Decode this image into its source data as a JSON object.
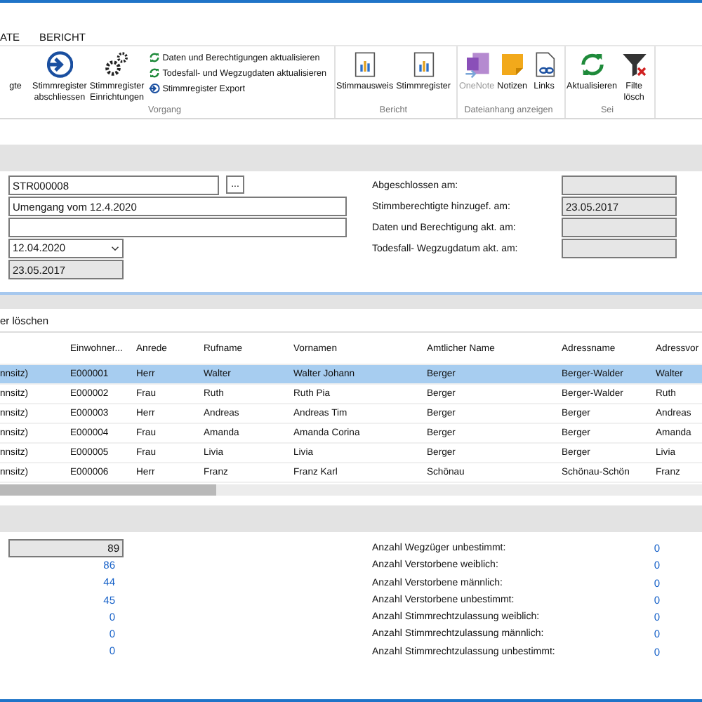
{
  "ribbon_tabs": [
    "ATE",
    "BERICHT"
  ],
  "ribbon_groups": [
    {
      "label": "Vorgang",
      "buttons": [
        {
          "kind": "none",
          "lines": [
            "gte"
          ],
          "disabled": false
        },
        {
          "kind": "arrow",
          "lines": [
            "Stimmregister",
            "abschliessen"
          ],
          "disabled": false
        },
        {
          "kind": "gears",
          "lines": [
            "Stimmregister",
            "Einrichtungen"
          ],
          "disabled": false
        }
      ],
      "small_buttons": [
        {
          "kind": "refresh",
          "label": "Daten und Berechtigungen aktualisieren"
        },
        {
          "kind": "refresh",
          "label": "Todesfall- und Wegzugdaten aktualisieren"
        },
        {
          "kind": "arrow",
          "label": "Stimmregister Export"
        }
      ]
    },
    {
      "label": "Bericht",
      "buttons": [
        {
          "kind": "report",
          "lines": [
            "Stimmausweis"
          ],
          "disabled": false
        },
        {
          "kind": "report",
          "lines": [
            "Stimmregister"
          ],
          "disabled": false
        }
      ]
    },
    {
      "label": "Dateianhang anzeigen",
      "buttons": [
        {
          "kind": "onenote",
          "lines": [
            "OneNote"
          ],
          "disabled": true
        },
        {
          "kind": "note",
          "lines": [
            "Notizen"
          ],
          "disabled": false
        },
        {
          "kind": "link",
          "lines": [
            "Links"
          ],
          "disabled": false
        }
      ]
    },
    {
      "label": "Sei",
      "buttons": [
        {
          "kind": "refresh",
          "lines": [
            "Aktualisieren"
          ],
          "disabled": false
        },
        {
          "kind": "filter",
          "lines": [
            "Filte",
            "lösch"
          ],
          "disabled": false
        }
      ]
    }
  ],
  "form": {
    "number": "STR000008",
    "browse_button": "...",
    "description": "Umengang vom 12.4.2020",
    "date": "12.04.2020",
    "created": "23.05.2017",
    "right": [
      {
        "label": "Abgeschlossen am:"
      },
      {
        "label": "Stimmberechtigte hinzugef. am:",
        "value": "23.05.2017"
      },
      {
        "label": "Daten und Berechtigung akt. am:"
      },
      {
        "label": "Todesfall- Wegzugdatum akt. am:"
      }
    ]
  },
  "table": {
    "toolbar_button": "er löschen",
    "columns": [
      "",
      "Einwohner...",
      "Anrede",
      "Rufname",
      "Vornamen",
      "Amtlicher Name",
      "Adressname",
      "Adressvor"
    ],
    "rows": [
      {
        "selected": true,
        "cells": [
          "nnsitz)",
          "E000001",
          "Herr",
          "Walter",
          "Walter Johann",
          "Berger",
          "Berger-Walder",
          "Walter"
        ]
      },
      {
        "selected": false,
        "cells": [
          "nnsitz)",
          "E000002",
          "Frau",
          "Ruth",
          "Ruth Pia",
          "Berger",
          "Berger-Walder",
          "Ruth"
        ]
      },
      {
        "selected": false,
        "cells": [
          "nnsitz)",
          "E000003",
          "Herr",
          "Andreas",
          "Andreas Tim",
          "Berger",
          "Berger",
          "Andreas"
        ]
      },
      {
        "selected": false,
        "cells": [
          "nnsitz)",
          "E000004",
          "Frau",
          "Amanda",
          "Amanda Corina",
          "Berger",
          "Berger",
          "Amanda"
        ]
      },
      {
        "selected": false,
        "cells": [
          "nnsitz)",
          "E000005",
          "Frau",
          "Livia",
          "Livia",
          "Berger",
          "Berger",
          "Livia"
        ]
      },
      {
        "selected": false,
        "cells": [
          "nnsitz)",
          "E000006",
          "Herr",
          "Franz",
          "Franz Karl",
          "Schönau",
          "Schönau-Schön",
          "Franz"
        ]
      }
    ]
  },
  "stats": {
    "total": "89",
    "left_values": [
      "86",
      "44",
      "45",
      "0",
      "0",
      "0"
    ],
    "right": [
      {
        "label": "Anzahl Wegzüger unbestimmt:",
        "value": "0"
      },
      {
        "label": "Anzahl Verstorbene weiblich:",
        "value": "0"
      },
      {
        "label": "Anzahl Verstorbene männlich:",
        "value": "0"
      },
      {
        "label": "Anzahl Verstorbene unbestimmt:",
        "value": "0"
      },
      {
        "label": "Anzahl Stimmrechtzulassung weiblich:",
        "value": "0"
      },
      {
        "label": "Anzahl Stimmrechtzulassung männlich:",
        "value": "0"
      },
      {
        "label": "Anzahl Stimmrechtzulassung unbestimmt:",
        "value": "0"
      }
    ]
  }
}
